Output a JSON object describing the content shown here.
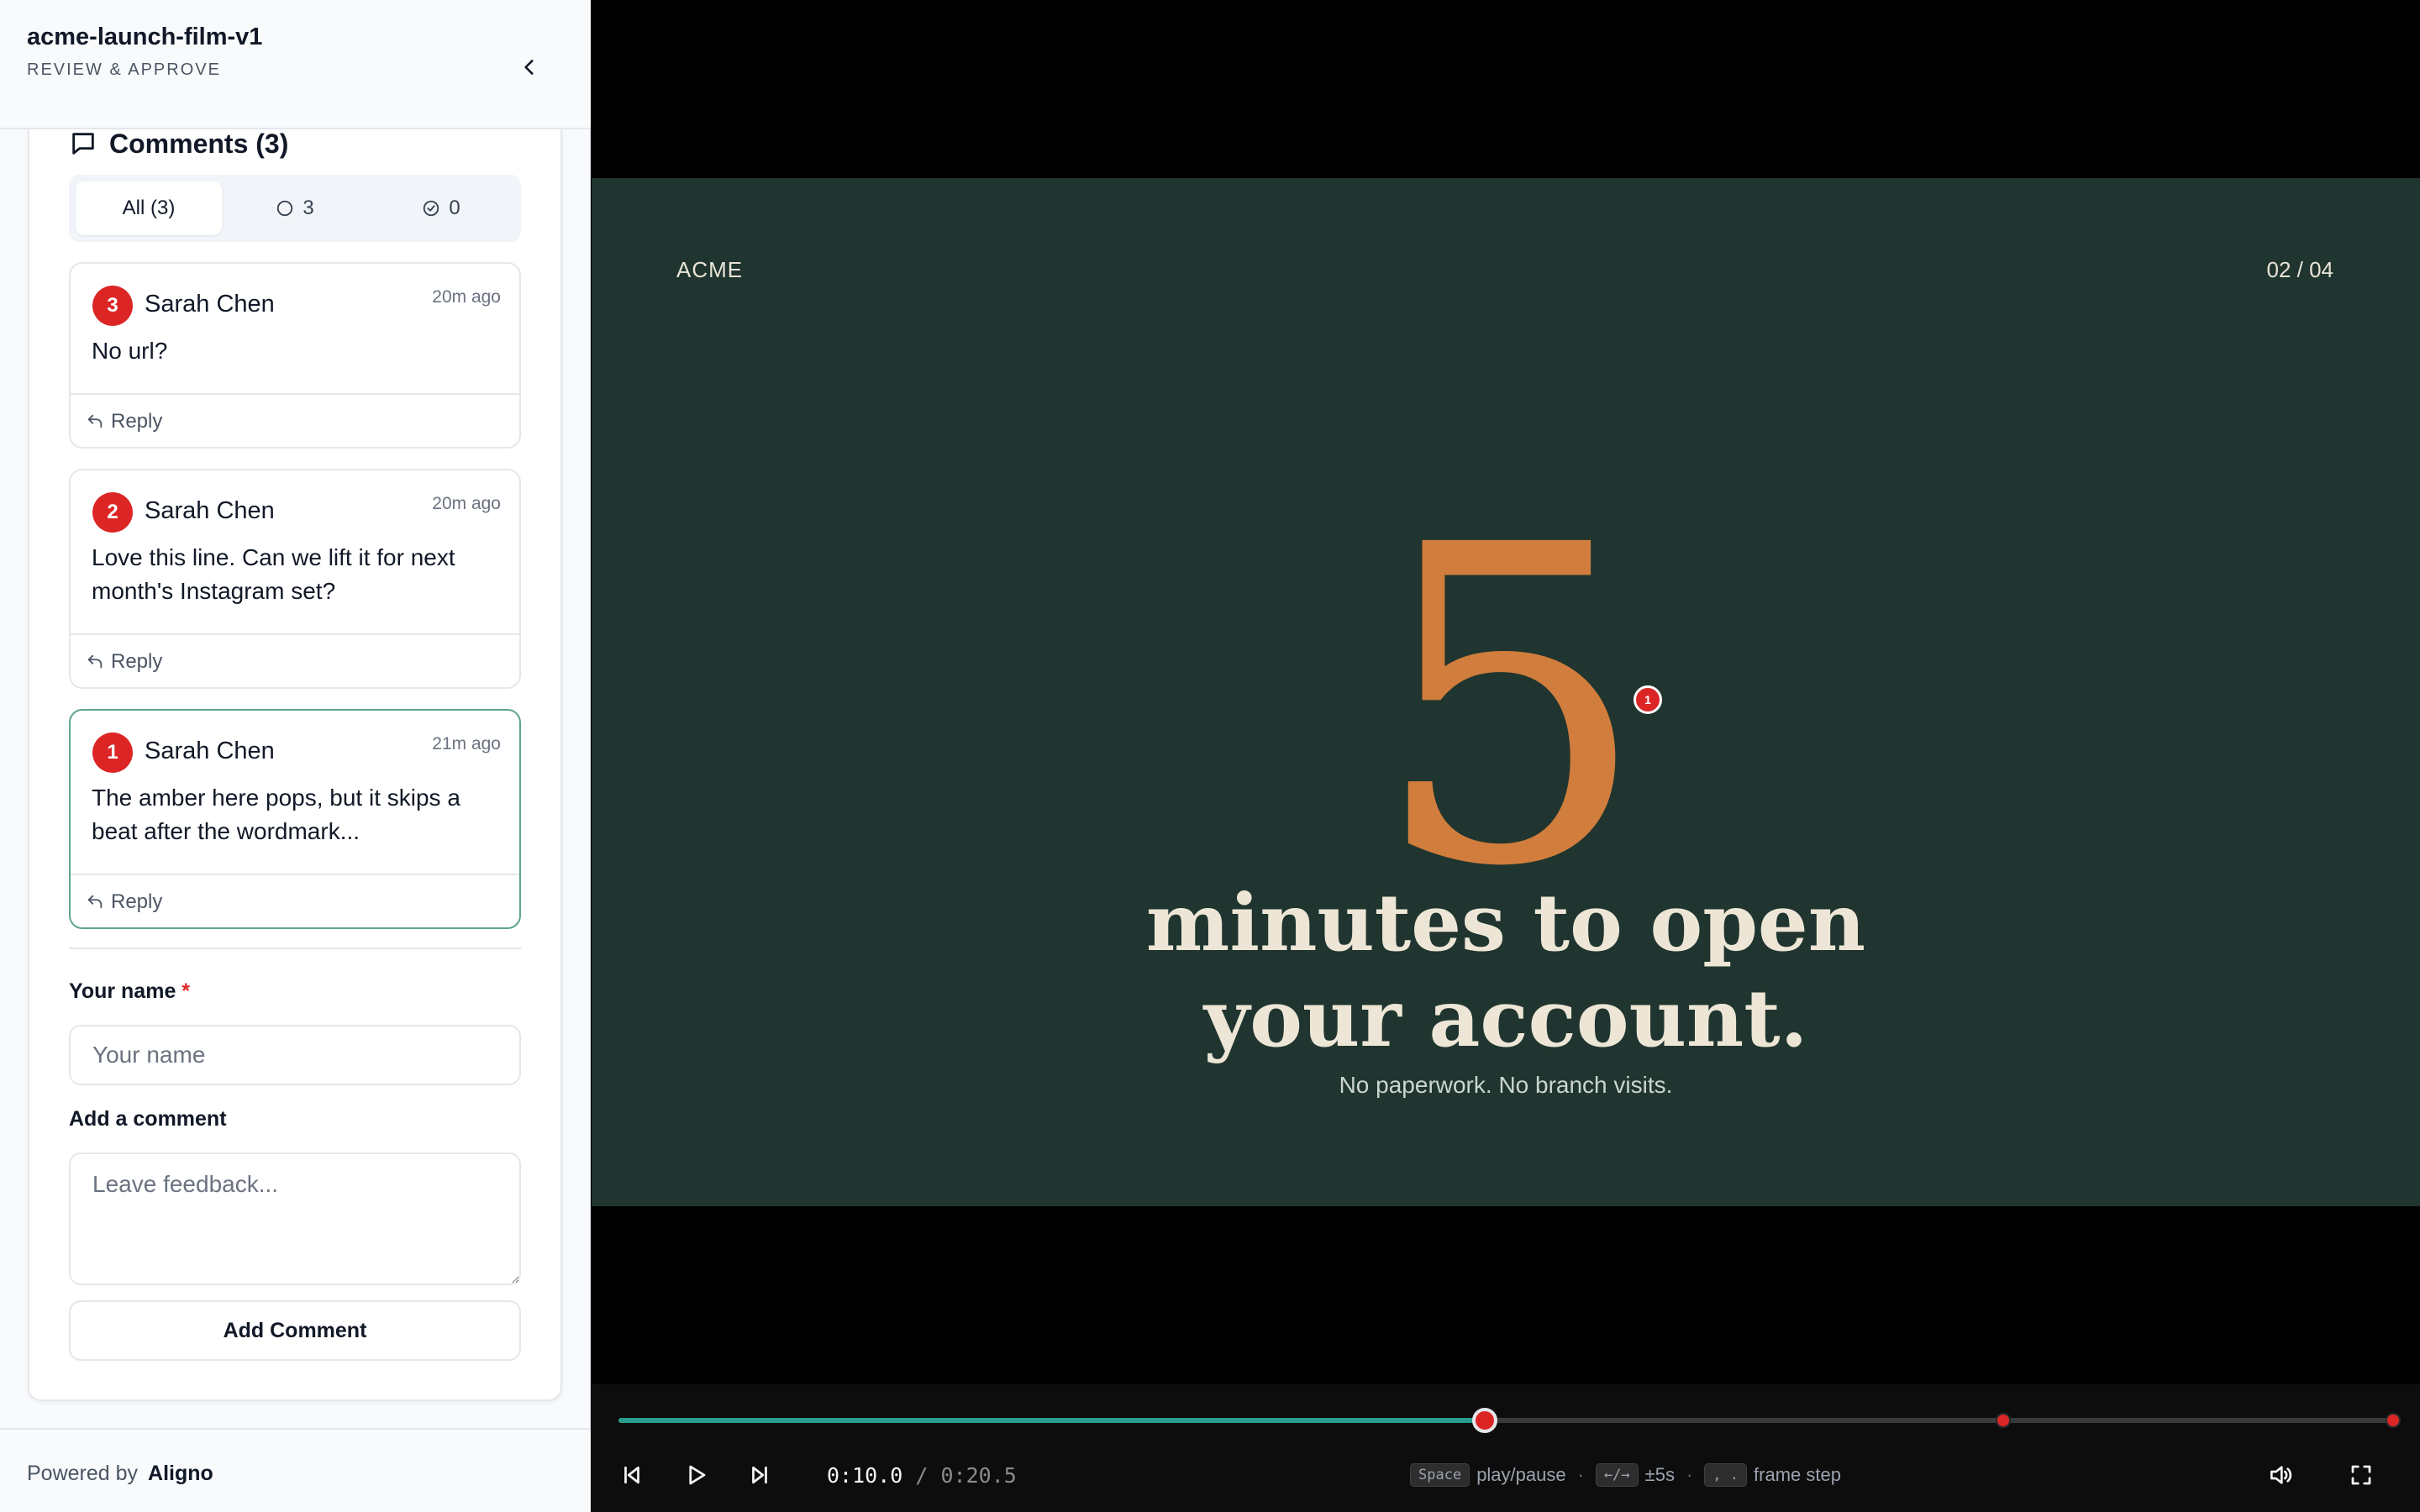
{
  "sidebar": {
    "title": "acme-launch-film-v1",
    "subtitle": "REVIEW & APPROVE",
    "comments_title": "Comments (3)",
    "filters": [
      {
        "label": "All (3)"
      },
      {
        "label": "3"
      },
      {
        "label": "0"
      }
    ],
    "comments": [
      {
        "number": "3",
        "author": "Sarah Chen",
        "time": "20m ago",
        "text": "No url?",
        "reply": "Reply"
      },
      {
        "number": "2",
        "author": "Sarah Chen",
        "time": "20m ago",
        "text": "Love this line. Can we lift it for next month's Instagram set?",
        "reply": "Reply"
      },
      {
        "number": "1",
        "author": "Sarah Chen",
        "time": "21m ago",
        "text": "The amber here pops, but it skips a beat after the wordmark...",
        "reply": "Reply"
      }
    ],
    "form": {
      "name_label": "Your name",
      "required_mark": "*",
      "name_placeholder": "Your name",
      "comment_label": "Add a comment",
      "comment_placeholder": "Leave feedback...",
      "submit_label": "Add Comment"
    },
    "footer": {
      "powered_by": "Powered by",
      "brand": "Aligno"
    }
  },
  "video": {
    "slide_brand": "ACME",
    "slide_counter": "02 / 04",
    "big_number": "5",
    "headline_line1": "minutes to open",
    "headline_line2": "your account.",
    "subline": "No paperwork. No branch visits.",
    "pin_number": "1"
  },
  "controls": {
    "current_time": "0:10.0",
    "separator": "/",
    "duration": "0:20.5",
    "progress_fraction": 0.488,
    "comment_markers_seconds": [
      10.0,
      16.0,
      23.8
    ],
    "shortcuts": [
      {
        "key": "Space",
        "action": "play/pause"
      },
      {
        "key": "←/→",
        "action": "±5s"
      },
      {
        "key": ", .",
        "action": "frame step"
      }
    ],
    "separator_dot": "·"
  },
  "colors": {
    "accent_teal": "#2a9d8f",
    "badge_red": "#dc2626",
    "slide_bg": "#20352f",
    "amber": "#d17d3d",
    "cream": "#ede6d6"
  }
}
